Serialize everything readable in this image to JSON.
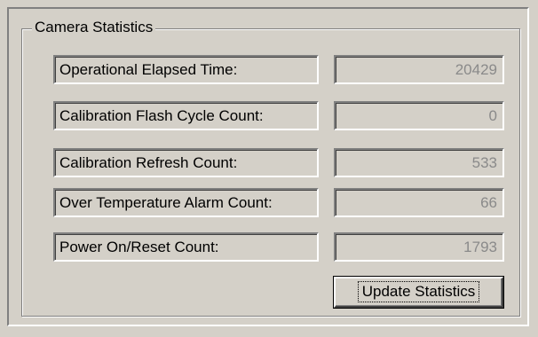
{
  "group": {
    "title": "Camera Statistics"
  },
  "stats": [
    {
      "label": "Operational Elapsed Time:",
      "value": "20429"
    },
    {
      "label": "Calibration Flash Cycle Count:",
      "value": "0"
    },
    {
      "label": "Calibration Refresh Count:",
      "value": "533"
    },
    {
      "label": "Over Temperature Alarm Count:",
      "value": "66"
    },
    {
      "label": "Power On/Reset Count:",
      "value": "1793"
    }
  ],
  "buttons": {
    "update_label": "Update Statistics"
  }
}
